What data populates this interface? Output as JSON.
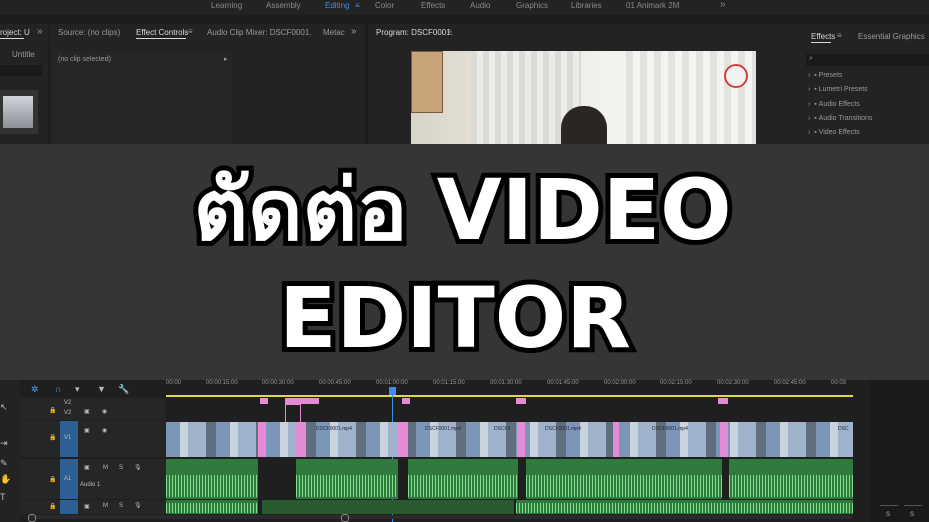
{
  "workspaces": [
    "Learning",
    "Assembly",
    "Editing",
    "Color",
    "Effects",
    "Audio",
    "Graphics",
    "Libraries",
    "01 Animark 2M"
  ],
  "workspace_active": "Editing",
  "workspace_more": "»",
  "project_panel": {
    "tab": "roject: U",
    "item": "Untitle",
    "more": "»"
  },
  "source_panel": {
    "tabs": [
      "Source: (no clips)",
      "Effect Controls",
      "Audio Clip Mixer: DSCF0001.",
      "Metac"
    ],
    "active_tab": "Effect Controls",
    "no_clip_text": "(no clip selected)"
  },
  "program_panel": {
    "tab": "Program: DSCF0001."
  },
  "effects_panel": {
    "tabs": [
      "Effects",
      "Essential Graphics"
    ],
    "items": [
      "Presets",
      "Lumetri Presets",
      "Audio Effects",
      "Audio Transitions",
      "Video Effects"
    ]
  },
  "overlay": {
    "line1": "ตัดต่อ VIDEO",
    "line2": "EDITOR"
  },
  "timeline": {
    "timecodes": [
      "00:00",
      "00:00:15:00",
      "00:00:30:00",
      "00:00:45:00",
      "00:01:00:00",
      "00:01:15:00",
      "00:01:30:00",
      "00:01:45:00",
      "00:02:00:00",
      "00:02:15:00",
      "00:02:30:00",
      "00:02:45:00",
      "00:03"
    ],
    "tracks": {
      "v2": "V2",
      "v1": "V1",
      "a1": "A1",
      "audio1": "Audio 1",
      "v1_small": "V1",
      "m": "M",
      "s": "S"
    },
    "clip_labels": [
      "DSCF0001.mp4",
      "DSCF0001.mp4",
      "DSCF0",
      "DSCF0001.mp4",
      "DSCF0001.mp4",
      "DSC"
    ],
    "meter_labels": [
      "S",
      "S"
    ]
  },
  "colors": {
    "accent": "#3b8fe8",
    "video_clip": "#8fb0dd",
    "audio_clip": "#2f7a3c",
    "transition": "#e58ad6",
    "banner": "#353535"
  }
}
